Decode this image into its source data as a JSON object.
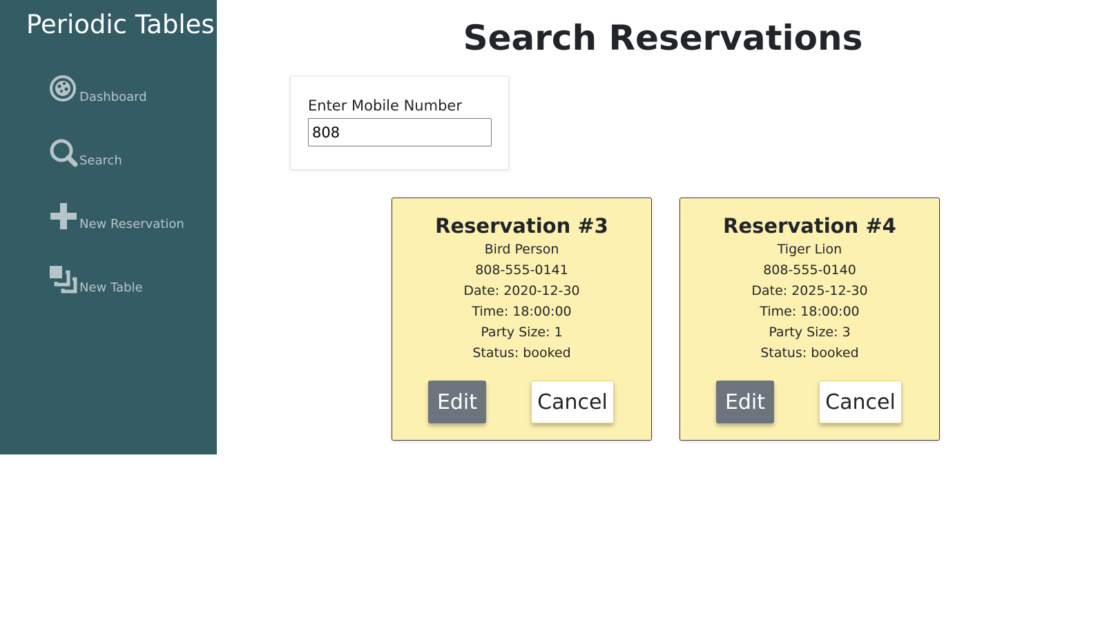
{
  "sidebar": {
    "brand": "Periodic Tables",
    "items": [
      {
        "label": "Dashboard",
        "icon": "dashboard-icon"
      },
      {
        "label": "Search",
        "icon": "search-icon"
      },
      {
        "label": "New Reservation",
        "icon": "plus-icon"
      },
      {
        "label": "New Table",
        "icon": "layers-icon"
      }
    ],
    "colors": {
      "background": "#345c65",
      "text": "#b7c5c9"
    }
  },
  "main": {
    "title": "Search Reservations",
    "search": {
      "label": "Enter Mobile Number",
      "value": "808"
    },
    "reservations": [
      {
        "title": "Reservation #3",
        "name": "Bird Person",
        "phone": "808-555-0141",
        "date": "Date: 2020-12-30",
        "time": "Time: 18:00:00",
        "party_size": "Party Size: 1",
        "status": "Status: booked",
        "edit_label": "Edit",
        "cancel_label": "Cancel"
      },
      {
        "title": "Reservation #4",
        "name": "Tiger Lion",
        "phone": "808-555-0140",
        "date": "Date: 2025-12-30",
        "time": "Time: 18:00:00",
        "party_size": "Party Size: 3",
        "status": "Status: booked",
        "edit_label": "Edit",
        "cancel_label": "Cancel"
      }
    ],
    "colors": {
      "card": "#fdf1b1",
      "edit_button": "#6c757d"
    }
  }
}
